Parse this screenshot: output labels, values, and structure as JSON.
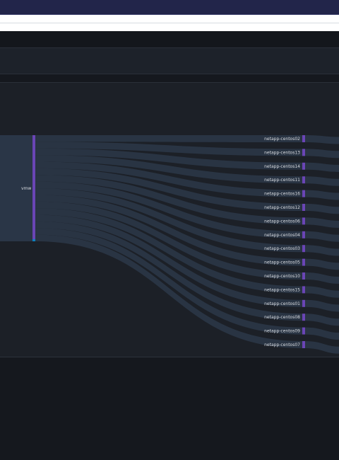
{
  "colors": {
    "flow": "#2d3b4d",
    "node": "#6a45b5",
    "source_node": "#6a45b5",
    "source_accent": "#0e7fbf",
    "label": "#d9dce1"
  },
  "chart_data": {
    "type": "sankey",
    "source": "vmw",
    "targets": [
      "netapp-centos02",
      "netapp-centos13",
      "netapp-centos14",
      "netapp-centos11",
      "netapp-centos16",
      "netapp-centos12",
      "netapp-centos06",
      "netapp-centos04",
      "netapp-centos03",
      "netapp-centos05",
      "netapp-centos10",
      "netapp-centos15",
      "netapp-centos01",
      "netapp-centos08",
      "netapp-centos09",
      "netapp-centos07"
    ],
    "values": [
      1,
      1,
      1,
      1,
      1,
      1,
      1,
      1,
      1,
      1,
      1,
      1,
      1,
      1,
      1,
      1
    ]
  }
}
